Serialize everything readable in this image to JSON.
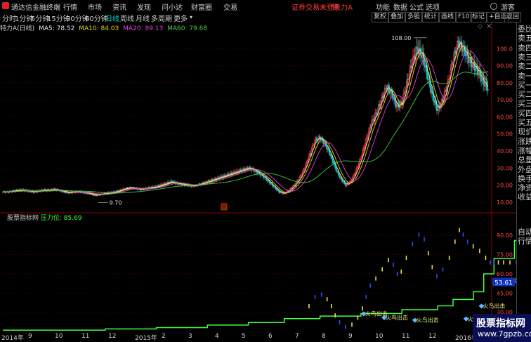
{
  "app": {
    "title": "通达信金融终端",
    "menu": [
      "行情",
      "市场",
      "资讯",
      "发现",
      "问小达",
      "财富圈",
      "交易"
    ],
    "login_notice": "证券交易未登录",
    "stock_title": "特 力A",
    "right_menu": [
      "功能",
      "数据",
      "公式",
      "选项",
      "游客"
    ],
    "colors": {
      "accent": "#00dede",
      "red": "#ff3b3b",
      "up": "#ff4040",
      "down": "#00c0c0"
    }
  },
  "toolbar": {
    "periods": [
      "分时",
      "1分钟",
      "5分钟",
      "15分钟",
      "30分钟",
      "60分钟",
      "日线",
      "周线",
      "月线",
      "多周期",
      "更多"
    ],
    "active_period": "日线",
    "buttons": [
      "复权",
      "叠加",
      "多股",
      "统计",
      "画线",
      "F10",
      "标记",
      "+自选",
      "返回"
    ]
  },
  "ma_legend": {
    "name": "特力A(日线)",
    "items": [
      {
        "label": "MA5: 78.52",
        "color": "#e6e6e6"
      },
      {
        "label": "MA10: 84.03",
        "color": "#e6d200"
      },
      {
        "label": "MA20: 89.13",
        "color": "#e040e0"
      },
      {
        "label": "MA60: 79.68",
        "color": "#40d040"
      }
    ]
  },
  "indicator_legend": {
    "name": "股票指标网",
    "label": "压力位: 85.69",
    "color": "#40ff40"
  },
  "main_axis_labels": [
    "100.0",
    "90.00",
    "80.00",
    "70.00",
    "60.00",
    "50.00",
    "40.00",
    "30.00",
    "20.00",
    "10.00"
  ],
  "ind_axis_labels": [
    "90.00",
    "75.00",
    "60.00",
    "45.00",
    "30.00"
  ],
  "ind_current_value": "53.61",
  "annotations": {
    "high": "108.00",
    "low": "9.70",
    "fire_label": "火鸟出击"
  },
  "x_axis": [
    "2014年",
    "9",
    "10",
    "11",
    "12",
    "2015年",
    "2",
    "3",
    "4",
    "5",
    "6",
    "7",
    "8",
    "9",
    "10",
    "11",
    "12",
    "2016年"
  ],
  "right_panel": [
    "委比",
    "卖五",
    "卖四",
    "卖三",
    "卖二",
    "卖一",
    "买一",
    "买二",
    "买三",
    "买四",
    "买五",
    "现价",
    "涨跌",
    "涨幅",
    "总量",
    "外盘",
    "换手",
    "净资",
    "收益",
    "自动",
    "行情"
  ],
  "watermark": {
    "line1": "股票指标网",
    "line2": "www.7gpzb.com"
  },
  "chart_data": [
    {
      "type": "candlestick",
      "title": "特力A(日线)",
      "ylim": [
        5,
        110
      ],
      "low_marker": 9.7,
      "high_marker": 108.0,
      "series": [
        {
          "name": "MA5",
          "last": 78.52
        },
        {
          "name": "MA10",
          "last": 84.03
        },
        {
          "name": "MA20",
          "last": 89.13
        },
        {
          "name": "MA60",
          "last": 79.68
        }
      ],
      "close_path": [
        16,
        16,
        16.5,
        17,
        17,
        16.5,
        16,
        16.5,
        17,
        17,
        17.5,
        17,
        16,
        15.5,
        16,
        16,
        15.5,
        15,
        14,
        14.5,
        15,
        15.5,
        16,
        17,
        18,
        18.5,
        18,
        17.5,
        18,
        18.5,
        19,
        20,
        21,
        22,
        21,
        20.5,
        20,
        19.5,
        20,
        21,
        22,
        23,
        24,
        25,
        26,
        27,
        28,
        29,
        30,
        29,
        27,
        25,
        22,
        19,
        16,
        15,
        17,
        20,
        24,
        30,
        38,
        46,
        48,
        44,
        38,
        30,
        24,
        20,
        22,
        28,
        36,
        46,
        56,
        62,
        70,
        78,
        74,
        66,
        68,
        80,
        92,
        100,
        96,
        84,
        72,
        64,
        70,
        80,
        94,
        104,
        100,
        94,
        90,
        86,
        80,
        76
      ]
    },
    {
      "type": "line",
      "title": "股票指标网",
      "ylim": [
        15,
        100
      ],
      "series": [
        {
          "name": "压力位",
          "last": 85.69,
          "steps": [
            [
              0,
              16
            ],
            [
              20,
              17
            ],
            [
              30,
              18
            ],
            [
              40,
              20
            ],
            [
              48,
              22
            ],
            [
              55,
              25
            ],
            [
              62,
              27
            ],
            [
              70,
              29
            ],
            [
              78,
              32
            ],
            [
              85,
              35
            ],
            [
              88,
              40
            ],
            [
              92,
              46
            ],
            [
              94,
              60
            ],
            [
              96,
              72
            ],
            [
              100,
              86
            ],
            [
              108,
              86
            ]
          ]
        }
      ],
      "current_value": 53.61
    }
  ]
}
